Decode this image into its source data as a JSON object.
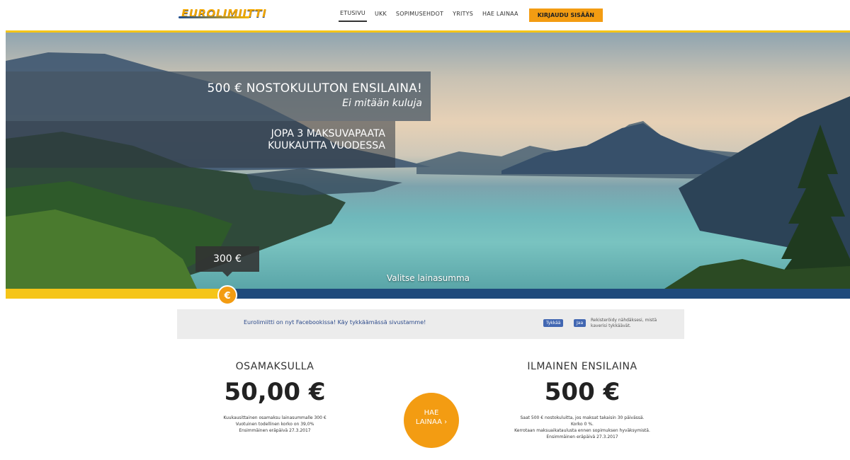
{
  "header": {
    "logo_text": "EUROLIMIITTI",
    "nav": [
      {
        "label": "ETUSIVU",
        "active": true
      },
      {
        "label": "UKK",
        "active": false
      },
      {
        "label": "SOPIMUSEHDOT",
        "active": false
      },
      {
        "label": "YRITYS",
        "active": false
      },
      {
        "label": "HAE LAINAA",
        "active": false
      }
    ],
    "login_label": "KIRJAUDU SISÄÄN"
  },
  "hero": {
    "headline": "500 € NOSTOKULUTON ENSILAINA!",
    "subheadline": "Ei mitään kuluja",
    "feature_line1": "JOPA 3 MAKSUVAPAATA",
    "feature_line2": "KUUKAUTTA VUODESSA",
    "selected_amount": "300 €",
    "slider_hint": "Valitse lainasumma",
    "slider_position": 0.26
  },
  "facebook": {
    "text": "Eurolimiitti on nyt Facebookissa! Käy tykkäämässä sivustamme!",
    "like_label": "Tykkää",
    "share_label": "Jaa",
    "note": "Rekisteröidy nähdäksesi, mistä kaverisi tykkäävät."
  },
  "info_left": {
    "title": "OSAMAKSULLA",
    "value": "50,00 €",
    "lines": [
      "Kuukausittainen osamaksu lainasummalle 300 €",
      "Vuotuinen todellinen korko on 39,0%",
      "Ensimmäinen eräpäivä 27.3.2017"
    ]
  },
  "cta": {
    "line1": "HAE",
    "line2": "LAINAA ›"
  },
  "info_right": {
    "title": "ILMAINEN ENSILAINA",
    "value": "500 €",
    "lines": [
      "Saat 500 € nostokuluitta, jos maksat takaisin 30 päivässä.",
      "Korko 0 %.",
      "Kerrotaan maksuaikataulusta ennen sopimuksen hyväksymistä.",
      "Ensimmäinen eräpäivä 27.3.2017"
    ]
  },
  "colors": {
    "brand_yellow": "#f5c518",
    "brand_orange": "#f39c12",
    "brand_blue": "#1f4a7c"
  }
}
